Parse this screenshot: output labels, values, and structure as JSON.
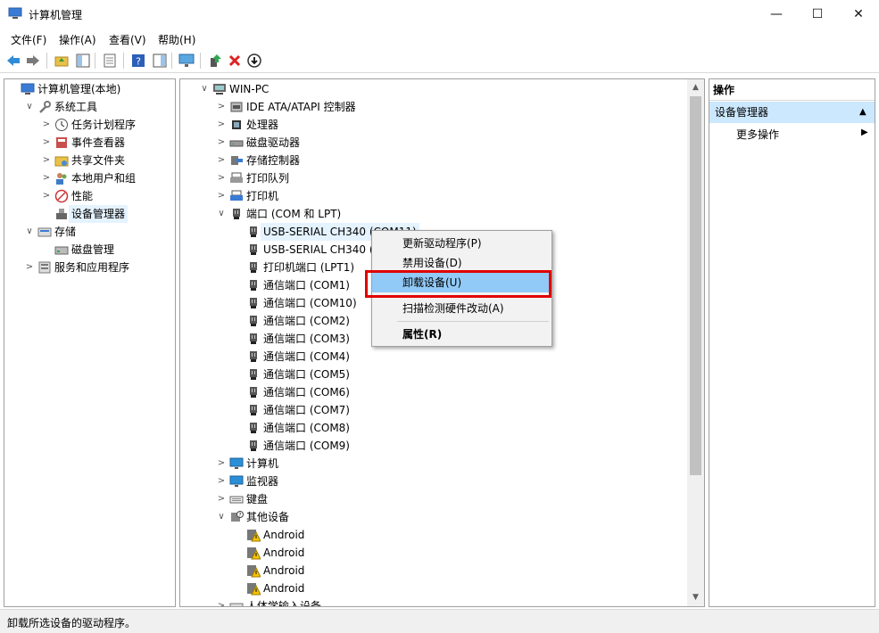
{
  "window": {
    "title": "计算机管理",
    "minimize_glyph": "—",
    "maximize_glyph": "☐",
    "close_glyph": "✕"
  },
  "menubar": [
    "文件(F)",
    "操作(A)",
    "查看(V)",
    "帮助(H)"
  ],
  "toolbar": {
    "icons": [
      "back-arrow-icon",
      "forward-arrow-icon",
      "up-folder-icon",
      "show-hide-tree-icon",
      "properties-icon",
      "help-icon",
      "action-pane-icon",
      "monitor-icon",
      "update-driver-icon",
      "uninstall-icon",
      "scan-icon"
    ]
  },
  "left_tree": [
    {
      "label": "计算机管理(本地)",
      "level": 0,
      "arrow": "",
      "icon": "computer-management-icon"
    },
    {
      "label": "系统工具",
      "level": 1,
      "arrow": "∨",
      "icon": "tools-icon"
    },
    {
      "label": "任务计划程序",
      "level": 2,
      "arrow": ">",
      "icon": "clock-icon"
    },
    {
      "label": "事件查看器",
      "level": 2,
      "arrow": ">",
      "icon": "event-viewer-icon"
    },
    {
      "label": "共享文件夹",
      "level": 2,
      "arrow": ">",
      "icon": "shared-folder-icon"
    },
    {
      "label": "本地用户和组",
      "level": 2,
      "arrow": ">",
      "icon": "users-icon"
    },
    {
      "label": "性能",
      "level": 2,
      "arrow": ">",
      "icon": "performance-icon"
    },
    {
      "label": "设备管理器",
      "level": 2,
      "arrow": "",
      "icon": "device-manager-icon",
      "selected": true
    },
    {
      "label": "存储",
      "level": 1,
      "arrow": "∨",
      "icon": "storage-icon"
    },
    {
      "label": "磁盘管理",
      "level": 2,
      "arrow": "",
      "icon": "disk-icon"
    },
    {
      "label": "服务和应用程序",
      "level": 1,
      "arrow": ">",
      "icon": "services-icon"
    }
  ],
  "device_tree": [
    {
      "label": "WIN-PC",
      "level": 0,
      "arrow": "∨",
      "icon": "computer-icon"
    },
    {
      "label": "IDE ATA/ATAPI 控制器",
      "level": 1,
      "arrow": ">",
      "icon": "ide-icon"
    },
    {
      "label": "处理器",
      "level": 1,
      "arrow": ">",
      "icon": "processor-icon"
    },
    {
      "label": "磁盘驱动器",
      "level": 1,
      "arrow": ">",
      "icon": "disk-drive-icon"
    },
    {
      "label": "存储控制器",
      "level": 1,
      "arrow": ">",
      "icon": "storage-controller-icon"
    },
    {
      "label": "打印队列",
      "level": 1,
      "arrow": ">",
      "icon": "print-queue-icon"
    },
    {
      "label": "打印机",
      "level": 1,
      "arrow": ">",
      "icon": "printer-icon"
    },
    {
      "label": "端口 (COM 和 LPT)",
      "level": 1,
      "arrow": "∨",
      "icon": "port-icon"
    },
    {
      "label": "USB-SERIAL CH340 (COM11)",
      "level": 2,
      "arrow": "",
      "icon": "port-icon",
      "selected": true
    },
    {
      "label": "USB-SERIAL CH340 (COM12)",
      "level": 2,
      "arrow": "",
      "icon": "port-icon"
    },
    {
      "label": "打印机端口 (LPT1)",
      "level": 2,
      "arrow": "",
      "icon": "port-icon"
    },
    {
      "label": "通信端口 (COM1)",
      "level": 2,
      "arrow": "",
      "icon": "port-icon"
    },
    {
      "label": "通信端口 (COM10)",
      "level": 2,
      "arrow": "",
      "icon": "port-icon"
    },
    {
      "label": "通信端口 (COM2)",
      "level": 2,
      "arrow": "",
      "icon": "port-icon"
    },
    {
      "label": "通信端口 (COM3)",
      "level": 2,
      "arrow": "",
      "icon": "port-icon"
    },
    {
      "label": "通信端口 (COM4)",
      "level": 2,
      "arrow": "",
      "icon": "port-icon"
    },
    {
      "label": "通信端口 (COM5)",
      "level": 2,
      "arrow": "",
      "icon": "port-icon"
    },
    {
      "label": "通信端口 (COM6)",
      "level": 2,
      "arrow": "",
      "icon": "port-icon"
    },
    {
      "label": "通信端口 (COM7)",
      "level": 2,
      "arrow": "",
      "icon": "port-icon"
    },
    {
      "label": "通信端口 (COM8)",
      "level": 2,
      "arrow": "",
      "icon": "port-icon"
    },
    {
      "label": "通信端口 (COM9)",
      "level": 2,
      "arrow": "",
      "icon": "port-icon"
    },
    {
      "label": "计算机",
      "level": 1,
      "arrow": ">",
      "icon": "monitor-icon"
    },
    {
      "label": "监视器",
      "level": 1,
      "arrow": ">",
      "icon": "monitor-icon"
    },
    {
      "label": "键盘",
      "level": 1,
      "arrow": ">",
      "icon": "keyboard-icon"
    },
    {
      "label": "其他设备",
      "level": 1,
      "arrow": "∨",
      "icon": "other-devices-icon"
    },
    {
      "label": "Android",
      "level": 2,
      "arrow": "",
      "icon": "warning-device-icon"
    },
    {
      "label": "Android",
      "level": 2,
      "arrow": "",
      "icon": "warning-device-icon"
    },
    {
      "label": "Android",
      "level": 2,
      "arrow": "",
      "icon": "warning-device-icon"
    },
    {
      "label": "Android",
      "level": 2,
      "arrow": "",
      "icon": "warning-device-icon"
    },
    {
      "label": "人体学输入设备",
      "level": 1,
      "arrow": ">",
      "icon": "hid-icon"
    }
  ],
  "context_menu": {
    "items": [
      "更新驱动程序(P)",
      "禁用设备(D)",
      "卸载设备(U)",
      "扫描检测硬件改动(A)",
      "属性(R)"
    ],
    "highlighted_index": 2,
    "highlight_color": "#91c9f7",
    "callout_color": "#e00000"
  },
  "actions_pane": {
    "header": "操作",
    "section": "设备管理器",
    "section_arrow": "▲",
    "item": "更多操作",
    "item_arrow": "▶"
  },
  "scrollbar": {
    "up": "▲",
    "down": "▼"
  },
  "status": "卸载所选设备的驱动程序。"
}
